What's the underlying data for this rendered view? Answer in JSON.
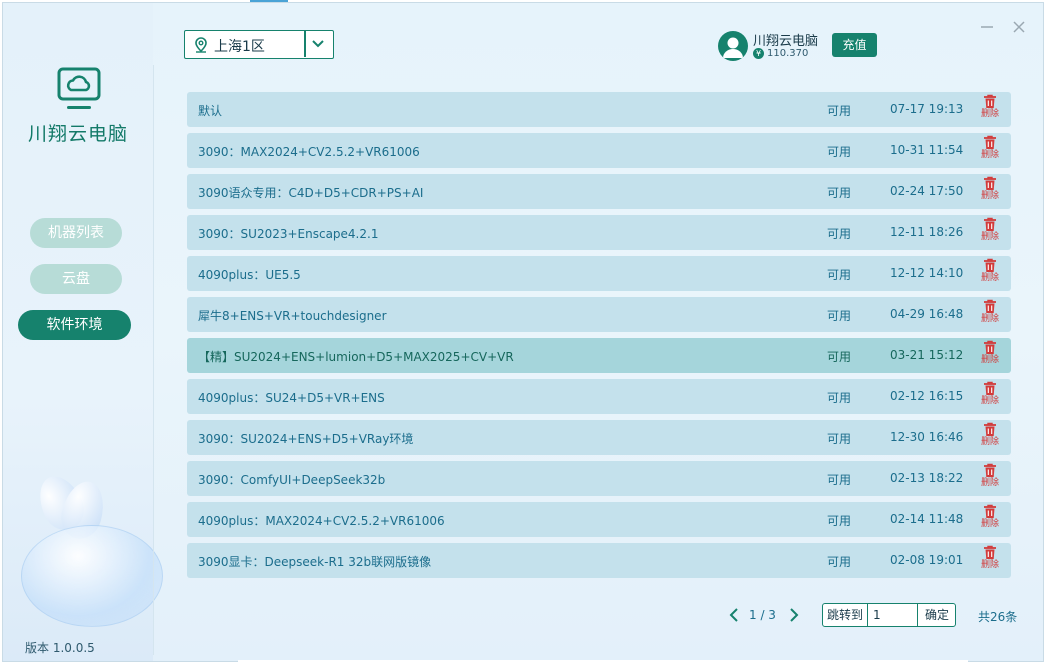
{
  "app": {
    "name": "川翔云电脑",
    "version": "版本 1.0.0.5"
  },
  "sidebar": {
    "items": [
      {
        "label": "机器列表",
        "active": false
      },
      {
        "label": "云盘",
        "active": false
      },
      {
        "label": "软件环境",
        "active": true
      }
    ]
  },
  "header": {
    "region": "上海1区",
    "user": {
      "name": "川翔云电脑",
      "balance": "110.370",
      "currency_symbol": "¥"
    },
    "recharge_label": "充值"
  },
  "list": {
    "delete_label": "删除",
    "rows": [
      {
        "name": "默认",
        "status": "可用",
        "time": "07-17 19:13"
      },
      {
        "name": "3090：MAX2024+CV2.5.2+VR61006",
        "status": "可用",
        "time": "10-31 11:54"
      },
      {
        "name": "3090语众专用：C4D+D5+CDR+PS+AI",
        "status": "可用",
        "time": "02-24 17:50"
      },
      {
        "name": "3090：SU2023+Enscape4.2.1",
        "status": "可用",
        "time": "12-11 18:26"
      },
      {
        "name": "4090plus：UE5.5",
        "status": "可用",
        "time": "12-12 14:10"
      },
      {
        "name": "犀牛8+ENS+VR+touchdesigner",
        "status": "可用",
        "time": "04-29 16:48"
      },
      {
        "name": "【精】SU2024+ENS+lumion+D5+MAX2025+CV+VR",
        "status": "可用",
        "time": "03-21 15:12",
        "highlighted": true
      },
      {
        "name": "4090plus：SU24+D5+VR+ENS",
        "status": "可用",
        "time": "02-12 16:15"
      },
      {
        "name": "3090：SU2024+ENS+D5+VRay环境",
        "status": "可用",
        "time": "12-30 16:46"
      },
      {
        "name": "3090：ComfyUI+DeepSeek32b",
        "status": "可用",
        "time": "02-13 18:22"
      },
      {
        "name": "4090plus：MAX2024+CV2.5.2+VR61006",
        "status": "可用",
        "time": "02-14 11:48"
      },
      {
        "name": "3090显卡：Deepseek-R1 32b联网版镜像",
        "status": "可用",
        "time": "02-08 19:01"
      }
    ]
  },
  "pagination": {
    "page_text": "1 / 3",
    "jump_label": "跳转到",
    "jump_value": "1",
    "confirm_label": "确定",
    "total": "共26条"
  },
  "colors": {
    "accent": "#16826d",
    "delete": "#d23b3b",
    "row_bg": "#c4e1ec",
    "row_highlight": "#a5d5db"
  }
}
